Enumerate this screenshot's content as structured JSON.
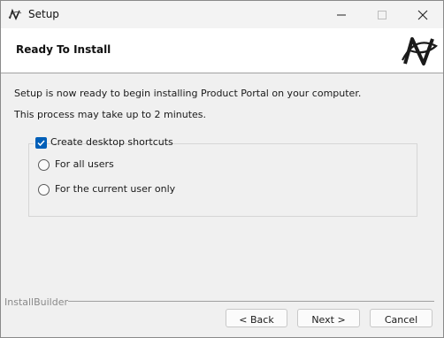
{
  "window": {
    "title": "Setup"
  },
  "header": {
    "title": "Ready To Install"
  },
  "body": {
    "line1": "Setup is now ready to begin installing Product Portal on your computer.",
    "line2": "This process may take up to 2 minutes."
  },
  "options": {
    "shortcuts_label": "Create desktop shortcuts",
    "shortcuts_checked": true,
    "radio_all": "For all users",
    "radio_current": "For the current user only"
  },
  "footer": {
    "brand": "InstallBuilder",
    "back_label": "< Back",
    "next_label": "Next >",
    "cancel_label": "Cancel"
  },
  "colors": {
    "accent": "#005fb8",
    "window_bg": "#f0f0f0",
    "header_bg": "#ffffff"
  },
  "icons": [
    "app-icon",
    "minimize-icon",
    "maximize-icon",
    "close-icon",
    "logo-icon",
    "checkmark-icon"
  ]
}
